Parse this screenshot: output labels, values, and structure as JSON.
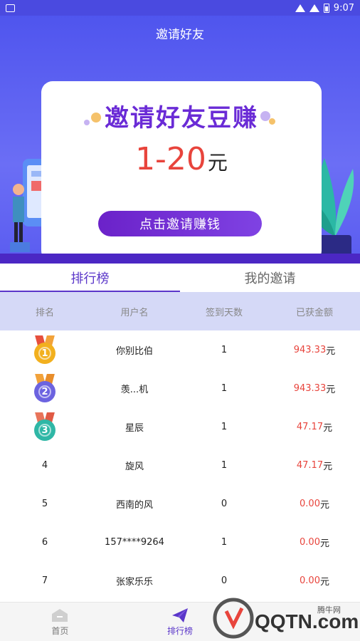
{
  "status_bar": {
    "time": "9:07"
  },
  "nav": {
    "title": "邀请好友"
  },
  "banner": {
    "headline": "邀请好友豆赚",
    "amount": "1-20",
    "amount_unit": "元",
    "cta_label": "点击邀请赚钱"
  },
  "tabs": [
    {
      "label": "排行榜",
      "active": true
    },
    {
      "label": "我的邀请",
      "active": false
    }
  ],
  "table": {
    "headers": [
      "排名",
      "用户名",
      "签到天数",
      "已获金额"
    ],
    "rows": [
      {
        "rank": "1",
        "medal": "gold",
        "name": "你别比伯",
        "days": "1",
        "amount": "943.33",
        "unit": "元"
      },
      {
        "rank": "2",
        "medal": "silver",
        "name": "羡...机",
        "days": "1",
        "amount": "943.33",
        "unit": "元"
      },
      {
        "rank": "3",
        "medal": "bronze",
        "name": "星辰",
        "days": "1",
        "amount": "47.17",
        "unit": "元"
      },
      {
        "rank": "4",
        "name": "旋风",
        "days": "1",
        "amount": "47.17",
        "unit": "元"
      },
      {
        "rank": "5",
        "name": "西南的风",
        "days": "0",
        "amount": "0.00",
        "unit": "元"
      },
      {
        "rank": "6",
        "name": "157****9264",
        "days": "1",
        "amount": "0.00",
        "unit": "元"
      },
      {
        "rank": "7",
        "name": "张家乐乐",
        "days": "0",
        "amount": "0.00",
        "unit": "元"
      }
    ]
  },
  "bottom_nav": [
    {
      "label": "首页",
      "icon": "home-icon",
      "active": false
    },
    {
      "label": "排行榜",
      "icon": "paper-plane-icon",
      "active": true
    },
    {
      "label": "",
      "icon": "",
      "active": false
    }
  ],
  "watermark": {
    "text": "QQTN.com",
    "brand": "腾牛网"
  },
  "colors": {
    "primary": "#5a36c9",
    "hero": "#5a5cf0",
    "money": "#e8443c",
    "table_header": "#d5d9f7"
  }
}
